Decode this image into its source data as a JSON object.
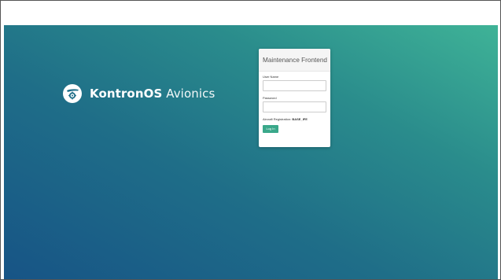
{
  "brand": {
    "name_bold": "KontronOS",
    "name_light": " Avionics",
    "logo_icon": "kontron-logo-icon"
  },
  "login": {
    "title": "Maintenance Frontend",
    "username_label": "User Name",
    "username_value": "",
    "password_label": "Password",
    "password_value": "",
    "registration_label": "Aircraft Registration:",
    "registration_value": "BASE_IFE",
    "login_button_label": "Log In"
  },
  "colors": {
    "background_top_right": "#3fb397",
    "background_bottom_left": "#175486",
    "button": "#3aa88a"
  }
}
